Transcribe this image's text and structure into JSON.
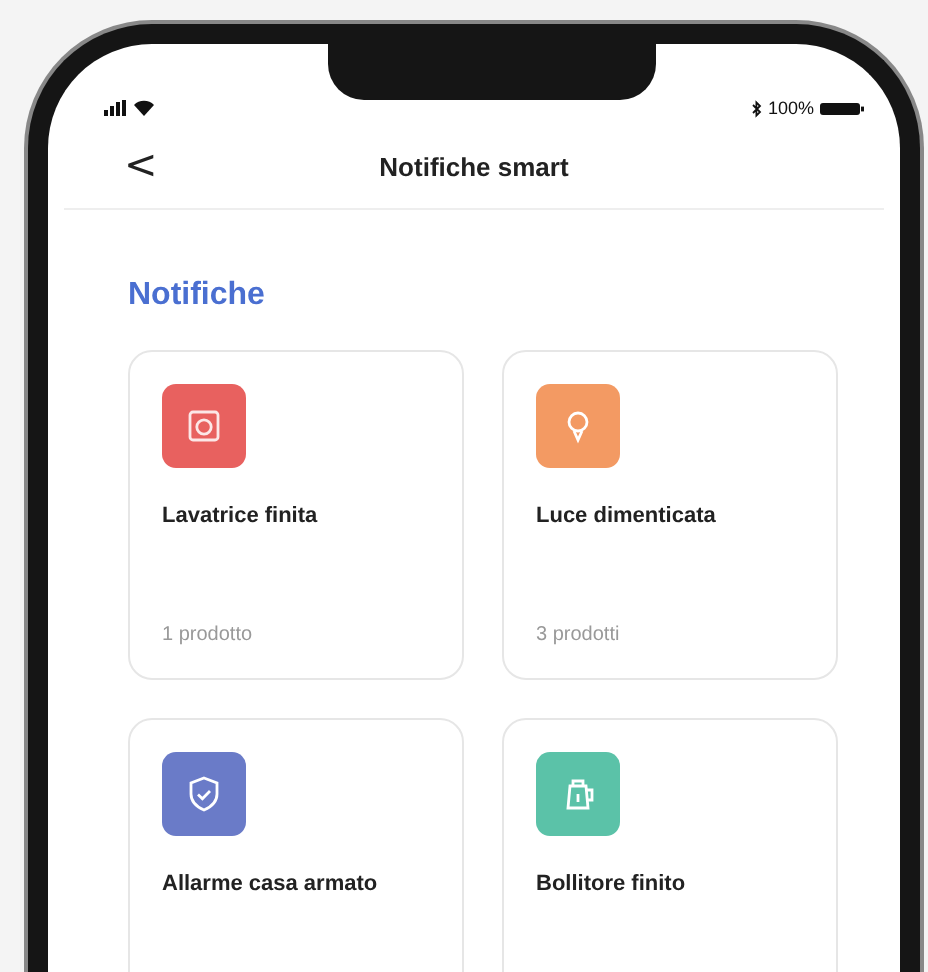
{
  "status_bar": {
    "battery": "100%"
  },
  "header": {
    "back": "<",
    "title": "Notifiche smart"
  },
  "section": {
    "title": "Notifiche"
  },
  "cards": [
    {
      "kind": "washer",
      "color": "#e8615f",
      "title": "Lavatrice finita",
      "count": "1 prodotto"
    },
    {
      "kind": "bulb",
      "color": "#f39a63",
      "title": "Luce dimenticata",
      "count": "3 prodotti"
    },
    {
      "kind": "shield",
      "color": "#6a7bc8",
      "title": "Allarme casa armato"
    },
    {
      "kind": "kettle",
      "color": "#5bc2a8",
      "title": "Bollitore finito"
    }
  ]
}
